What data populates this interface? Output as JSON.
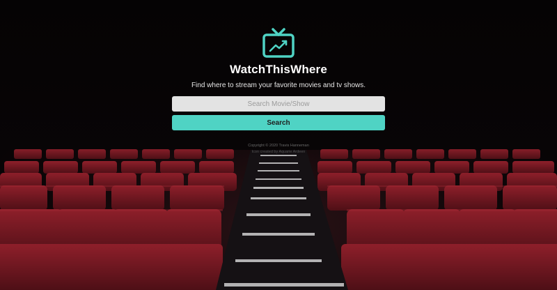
{
  "app": {
    "title": "WatchThisWhere",
    "tagline": "Find where to stream your favorite movies and tv shows."
  },
  "logo": {
    "icon": "tv-trending-icon",
    "color": "#4fd3c4"
  },
  "search": {
    "placeholder": "Search Movie/Show",
    "value": "",
    "button_label": "Search"
  },
  "footer": {
    "copyright": "Copyright © 2020 Travis Hanneman",
    "icon_credit": "Icon created by Aquarie Ardeen"
  },
  "background": {
    "scene": "movie-theater-seats",
    "seat_color": "#7a1a24"
  }
}
